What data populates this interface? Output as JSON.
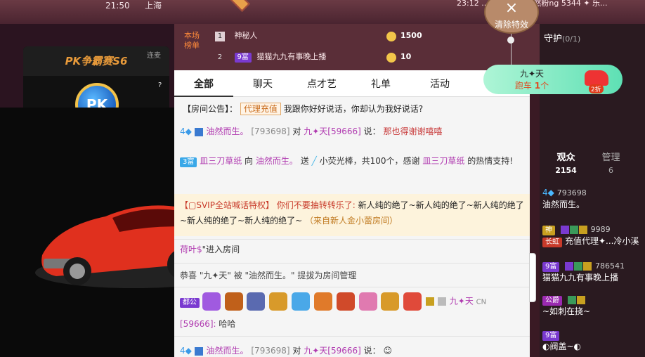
{
  "topbar": {
    "time": "21:50",
    "city": "上海",
    "right_text": "23:12 ...来达恰 喵 ❤ 然粉ng 5344 ✦ 乐..."
  },
  "pk_panel": {
    "title": "PK争霸赛S6",
    "top_right": "连麦",
    "badge": "PK",
    "help": "?"
  },
  "rank": {
    "title": "本场榜单",
    "rows": [
      {
        "num": "1",
        "name": "神秘人",
        "value": "1500"
      },
      {
        "num": "2",
        "badge": "9富",
        "name": "猫猫九九有事晚上播",
        "value": "10"
      }
    ]
  },
  "clear_effects": {
    "icon": "×",
    "label": "清除特效"
  },
  "run_car": {
    "user": "九✦天",
    "text_prefix": "跑车 ",
    "count": "1",
    "unit": "个",
    "badge": "2折"
  },
  "chat": {
    "tabs": [
      "全部",
      "聊天",
      "点才艺",
      "礼单",
      "活动"
    ],
    "notice_label": "【房间公告】：",
    "notice_tag": "代理充值",
    "notice_text": "我跟你好好说话，你却认为我好说话?",
    "msg1": {
      "level": "4",
      "user": "油然而生。",
      "id": "[793698]",
      "to": "对",
      "target": "九✦天[59666]",
      "said": "说：",
      "content": "那也得谢谢嘻嘻"
    },
    "msg2": {
      "badge": "3富",
      "user": "皿三刀草纸",
      "action": "向",
      "target": "油然而生。",
      "send": "送",
      "gift": "小荧光棒，共100个，感谢",
      "user2": "皿三刀草纸",
      "tail": "的热情支持!"
    },
    "svip": {
      "tag": "【▢SVIP全站喊话特权】",
      "user": "你们不要抽转转乐了:",
      "content": "新人纯的绝了~新人纯的绝了~新人纯的绝了~新人纯的绝了~新人纯的绝了~",
      "from": "（来自新人金小蕾房间）"
    },
    "enter": {
      "user": "荷叶$",
      "text": "\"进入房间"
    },
    "promote": {
      "text": "恭喜 \"九✦天\" 被 \"油然而生。\" 提拔为房间管理"
    },
    "msg3": {
      "badge": "都公",
      "user": "九✦天",
      "suffix": "CN",
      "id": "[59666]:",
      "content": "哈哈"
    },
    "msg4": {
      "level": "4",
      "user": "油然而生。",
      "id": "[793698]",
      "to": "对",
      "target": "九✦天[59666]",
      "said": "说："
    }
  },
  "right": {
    "guard": "守护",
    "guard_count": "(0/1)",
    "tabs": [
      {
        "label": "观众",
        "count": "2154"
      },
      {
        "label": "管理",
        "count": "6"
      }
    ],
    "audience": [
      {
        "level": "4",
        "id": "793698",
        "name": "油然而生。"
      },
      {
        "badge": "神",
        "id": "9989",
        "sub": "长虹",
        "name": "充值代理✦...冷小溪"
      },
      {
        "badge": "9富",
        "id": "786541",
        "name": "猫猫九九有事晚上播"
      },
      {
        "badge": "公爵",
        "name": "~如刺在挠~"
      },
      {
        "badge": "9富",
        "name": "◐阀盖~◐"
      }
    ]
  },
  "colors": {
    "accent": "#ff8a3a",
    "purple_user": "#b03ab0",
    "chat_bg": "#f5f5f5",
    "side_bg": "#2a1a20"
  }
}
